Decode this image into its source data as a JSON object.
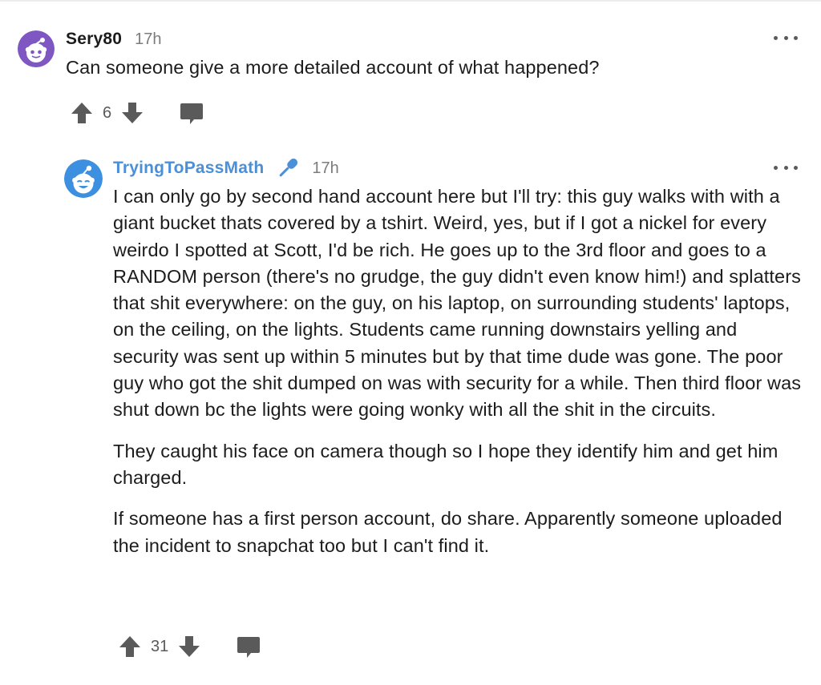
{
  "comments": [
    {
      "username": "Sery80",
      "time": "17h",
      "body": "Can someone give a more detailed account of what happened?",
      "votes": "6"
    },
    {
      "username": "TryingToPassMath",
      "time": "17h",
      "flair_icon": "microphone-icon",
      "paragraphs": [
        "I can only go by second hand account here but I'll try: this guy walks with with a giant bucket thats covered by a tshirt. Weird, yes, but if I got a nickel for every weirdo I spotted at Scott, I'd be rich. He goes up to the 3rd floor and goes to a RANDOM person (there's no grudge, the guy didn't even know him!) and splatters that shit everywhere: on the guy, on his laptop, on surrounding students' laptops, on the ceiling, on the lights. Students came running downstairs yelling and security was sent up within 5 minutes but by that time dude was gone. The poor guy who got the shit dumped on was with security for a while. Then third floor was shut down bc the lights were going wonky with all the shit in the circuits.",
        "They caught his face on camera though so I hope they identify him and get him charged.",
        "If someone has a first person account, do share. Apparently someone uploaded the incident to snapchat too but I can't find it."
      ],
      "votes": "31"
    }
  ],
  "colors": {
    "username_highlight": "#4a90d9",
    "avatar_1_bg": "#7e57c2",
    "avatar_2_bg": "#3d8fe0",
    "icon_gray": "#5a5a5a",
    "meta_gray": "#7c7c7c"
  },
  "icons": {
    "upvote": "upvote-arrow-icon",
    "downvote": "downvote-arrow-icon",
    "reply": "speech-bubble-icon",
    "more": "more-dots-icon"
  }
}
